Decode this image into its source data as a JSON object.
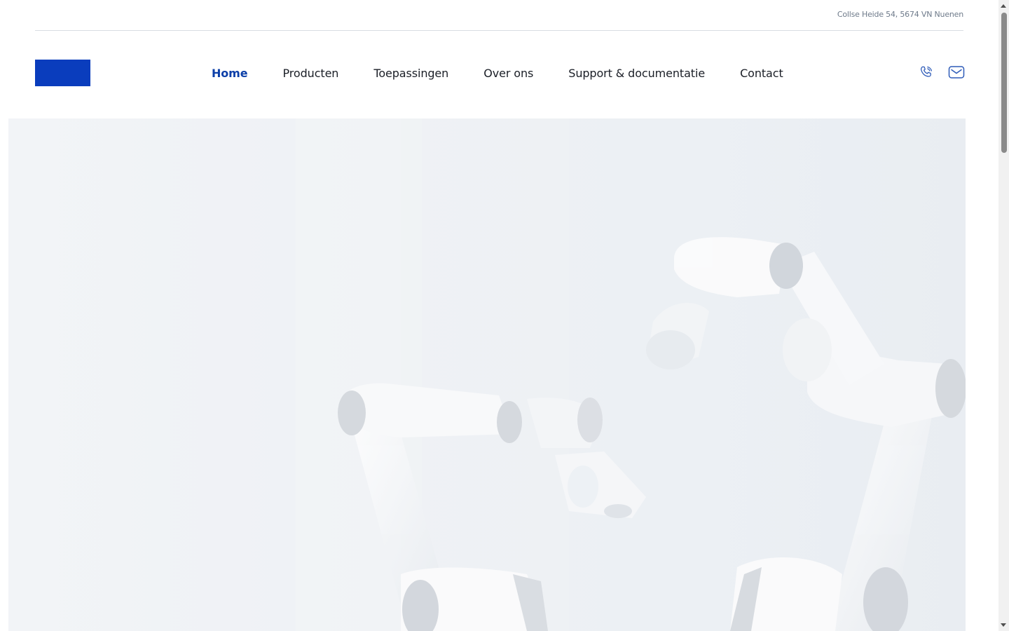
{
  "topbar": {
    "address": "Collse Heide 54, 5674 VN Nuenen"
  },
  "header": {
    "logo_color": "#0a3dbd",
    "nav": [
      {
        "label": "Home",
        "active": true
      },
      {
        "label": "Producten",
        "active": false
      },
      {
        "label": "Toepassingen",
        "active": false
      },
      {
        "label": "Over ons",
        "active": false
      },
      {
        "label": "Support & documentatie",
        "active": false
      },
      {
        "label": "Contact",
        "active": false
      }
    ],
    "icons": [
      "phone-icon",
      "mail-icon"
    ]
  },
  "hero": {
    "image": "collaborative-robot-arms"
  },
  "colors": {
    "accent": "#0c3fa8",
    "text": "#1a1e26",
    "muted": "#6e7a8a"
  }
}
